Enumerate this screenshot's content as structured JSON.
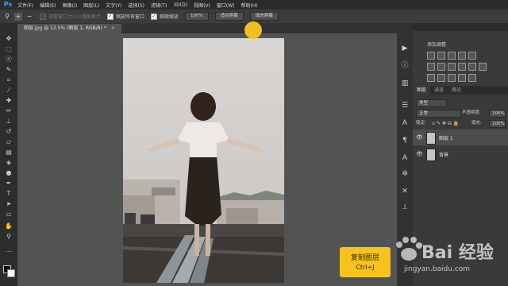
{
  "app": {
    "logo": "Ps"
  },
  "menu": [
    "文件(F)",
    "编辑(E)",
    "图像(I)",
    "图层(L)",
    "文字(Y)",
    "选择(S)",
    "滤镜(T)",
    "3D(D)",
    "视图(V)",
    "窗口(W)",
    "帮助(H)"
  ],
  "options_bar": {
    "resize_windows_label": "调整窗口大小以满屏显示",
    "zoom_all_windows_label": "缩放所有窗口",
    "scrubby_zoom_label": "细微缩放",
    "zoom_100_label": "100%",
    "fit_screen_label": "适合屏幕",
    "fill_screen_label": "填充屏幕"
  },
  "document_tab": {
    "title": "图层.jpg @ 12.5% (图层 1, RGB/8) *",
    "close": "×"
  },
  "adjustments_panel": {
    "title": "添加调整"
  },
  "layers_panel": {
    "tabs": [
      "图层",
      "通道",
      "路径"
    ],
    "filter_kind": "类型",
    "blend_mode": "正常",
    "opacity_label": "不透明度:",
    "opacity_value": "100%",
    "lock_label": "锁定:",
    "fill_label": "填充:",
    "fill_value": "100%",
    "layers": [
      {
        "name": "图层 1",
        "selected": true
      },
      {
        "name": "背景",
        "selected": false
      }
    ]
  },
  "tooltip": {
    "title": "复制图层",
    "shortcut": "Ctrl+J"
  },
  "watermark": {
    "text": "Bai 经验",
    "sub": "jingyan.baidu.com"
  },
  "icons": {
    "tools": [
      "move-icon",
      "marquee-icon",
      "lasso-icon",
      "quick-select-icon",
      "crop-icon",
      "eyedropper-icon",
      "healing-icon",
      "brush-icon",
      "stamp-icon",
      "history-brush-icon",
      "eraser-icon",
      "gradient-icon",
      "blur-icon",
      "dodge-icon",
      "pen-icon",
      "type-icon",
      "path-select-icon",
      "rectangle-icon",
      "hand-icon",
      "zoom-icon"
    ],
    "strip": [
      "play-icon",
      "info-icon",
      "histogram-icon",
      "properties-icon",
      "character-icon",
      "paragraph-icon",
      "adjust-icon",
      "tools-icon",
      "brush-preset-icon"
    ]
  }
}
